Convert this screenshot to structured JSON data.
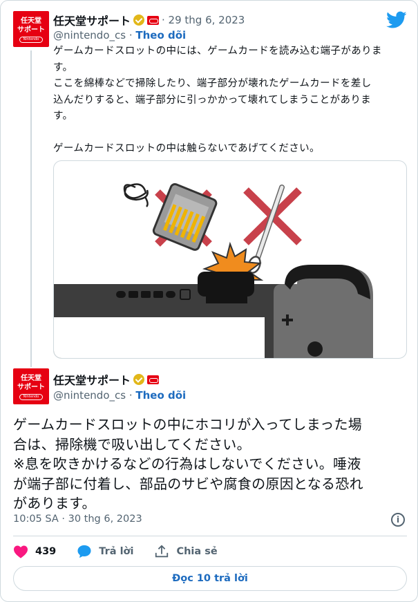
{
  "quoted_tweet": {
    "avatar": {
      "line1": "任天堂",
      "line2": "サポート",
      "logo": "Nintendo"
    },
    "display_name": "任天堂サポート",
    "date": "· 29 thg 6, 2023",
    "handle": "@nintendo_cs",
    "separator": " · ",
    "follow_label": "Theo dõi",
    "text_lines": [
      "ゲームカードスロットの中には、ゲームカードを読み込む端子がありま",
      "す。",
      "ここを綿棒などで掃除したり、端子部分が壊れたゲームカードを差し",
      "込んだりすると、端子部分に引っかかって壊れてしまうことがありま",
      "す。",
      "",
      "ゲームカードスロットの中は触らないであげてください。"
    ]
  },
  "main_tweet": {
    "avatar": {
      "line1": "任天堂",
      "line2": "サポート",
      "logo": "Nintendo"
    },
    "display_name": "任天堂サポート",
    "handle": "@nintendo_cs",
    "separator": " · ",
    "follow_label": "Theo dõi",
    "text_lines": [
      "ゲームカードスロットの中にホコリが入ってしまった場",
      "合は、掃除機で吸い出してください。",
      "※息を吹きかけるなどの行為はしないでください。唾液",
      "が端子部に付着し、部品のサビや腐食の原因となる恐れ",
      "があります。"
    ],
    "timestamp": "10:05 SA · 30 thg 6, 2023",
    "likes": "439",
    "reply_label": "Trả lời",
    "share_label": "Chia sẻ",
    "read_replies_label": "Đọc 10 trả lời"
  },
  "icons": {
    "twitter": "twitter-bird-icon",
    "verified": "verified-gold-icon",
    "like": "heart-icon",
    "reply": "speech-bubble-icon",
    "share": "share-upload-icon",
    "info": "info-icon"
  },
  "colors": {
    "brand_red": "#e60012",
    "twitter_blue": "#1d9bf0",
    "link_blue": "#1d6bbf",
    "heart": "#f91880",
    "verified_gold": "#e2b719",
    "cross_red": "#c8414b",
    "console_dark": "#3d3d3d"
  }
}
